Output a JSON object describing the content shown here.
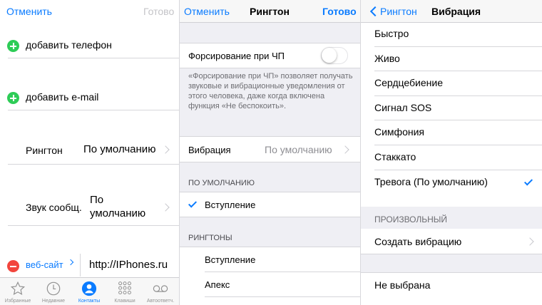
{
  "contact_edit": {
    "cancel": "Отменить",
    "done": "Готово",
    "add_phone": "добавить телефон",
    "add_email": "добавить e-mail",
    "ringtone_label": "Рингтон",
    "ringtone_value": "По умолчанию",
    "message_sound_label": "Звук сообщ.",
    "message_sound_value_line1": "По",
    "message_sound_value_line2": "умолчанию",
    "website_label": "веб-сайт",
    "website_value": "http://IPhones.ru",
    "tabs": [
      {
        "label": "Избранные",
        "icon": "star-icon",
        "active": false
      },
      {
        "label": "Недавние",
        "icon": "clock-icon",
        "active": false
      },
      {
        "label": "Контакты",
        "icon": "person-icon",
        "active": true
      },
      {
        "label": "Клавиши",
        "icon": "keypad-icon",
        "active": false
      },
      {
        "label": "Автоответч.",
        "icon": "voicemail-icon",
        "active": false
      }
    ]
  },
  "ringtone_screen": {
    "cancel": "Отменить",
    "title": "Рингтон",
    "done": "Готово",
    "emergency_bypass_label": "Форсирование при ЧП",
    "emergency_bypass_on": false,
    "emergency_description": "«Форсирование при ЧП» позволяет получать звуковые и вибрационные уведомления от этого человека, даже когда включена функция «Не беспокоить».",
    "vibration_label": "Вибрация",
    "vibration_value": "По умолчанию",
    "default_header": "ПО УМОЛЧАНИЮ",
    "default_item": "Вступление",
    "ringtones_header": "РИНГТОНЫ",
    "ringtones": [
      "Вступление",
      "Апекс"
    ]
  },
  "vibration_screen": {
    "back": "Рингтон",
    "title": "Вибрация",
    "items": [
      "Быстро",
      "Живо",
      "Сердцебиение",
      "Сигнал SOS",
      "Симфония",
      "Стаккато",
      "Тревога (По умолчанию)"
    ],
    "selected_index": 6,
    "custom_header": "ПРОИЗВОЛЬНЫЙ",
    "create_vibration": "Создать вибрацию",
    "none": "Не выбрана"
  },
  "colors": {
    "accent": "#0a7bff",
    "add": "#2ecc57",
    "remove": "#f2453d",
    "group_bg": "#efeff4"
  }
}
